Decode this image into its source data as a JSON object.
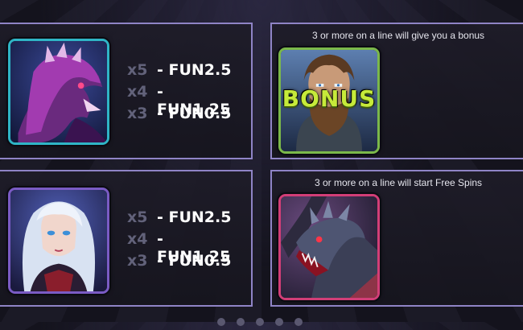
{
  "paytable": [
    {
      "symbol_icon": "purple-dragon-icon",
      "frame_color": "#2fb5c6",
      "payouts": [
        {
          "mult": "x5",
          "value": "- FUN2.5"
        },
        {
          "mult": "x4",
          "value": "- FUN1.25"
        },
        {
          "mult": "x3",
          "value": "- FUN0.5"
        }
      ]
    },
    {
      "symbol_icon": "bearded-warrior-icon",
      "frame_color": "#7bb84a",
      "caption": "3 or more on a line will give you a bonus",
      "badge": "BONUS"
    },
    {
      "symbol_icon": "silver-haired-sorceress-icon",
      "frame_color": "#7a5bc4",
      "payouts": [
        {
          "mult": "x5",
          "value": "- FUN2.5"
        },
        {
          "mult": "x4",
          "value": "- FUN1.25"
        },
        {
          "mult": "x3",
          "value": "- FUN0.5"
        }
      ]
    },
    {
      "symbol_icon": "black-dragon-icon",
      "frame_color": "#d23e77",
      "caption": "3 or more on a line will start Free Spins"
    }
  ],
  "colors": {
    "panel_border": "#8f84c6",
    "multiplier_text": "#62627a",
    "value_text": "#ffffff",
    "bonus_text": "#c6ea3a"
  }
}
